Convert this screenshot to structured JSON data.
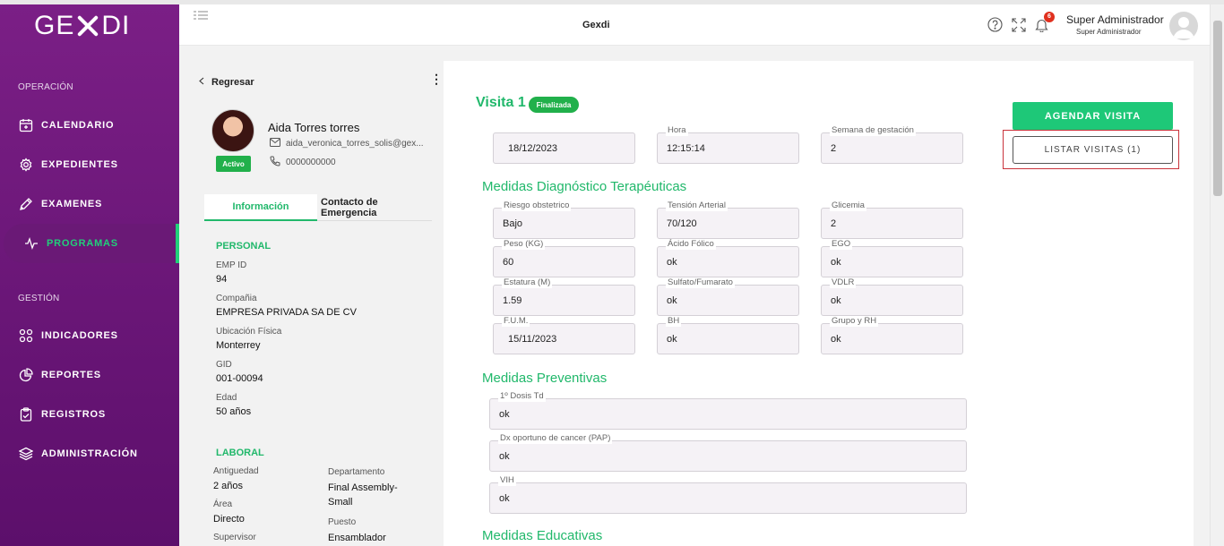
{
  "sidebar": {
    "logo_left": "GE",
    "logo_right": "DI",
    "section_operacion": "OPERACIÓN",
    "section_gestion": "GESTIÓN",
    "items": [
      {
        "label": "CALENDARIO",
        "icon": "calendar-icon"
      },
      {
        "label": "EXPEDIENTES",
        "icon": "gear-icon"
      },
      {
        "label": "EXAMENES",
        "icon": "pencil-icon"
      },
      {
        "label": "PROGRAMAS",
        "icon": "pulse-icon"
      },
      {
        "label": "INDICADORES",
        "icon": "grid-icon"
      },
      {
        "label": "REPORTES",
        "icon": "pie-chart-icon"
      },
      {
        "label": "REGISTROS",
        "icon": "clipboard-icon"
      },
      {
        "label": "ADMINISTRACIÓN",
        "icon": "layers-icon"
      }
    ],
    "active_color": "#21d07a"
  },
  "header": {
    "title": "Gexdi",
    "notification_count": "6",
    "user_name": "Super Administrador",
    "user_role": "Super Administrador"
  },
  "profile": {
    "back_label": "Regresar",
    "name": "Aida Torres torres",
    "email": "aida_veronica_torres_solis@gex...",
    "phone": "0000000000",
    "status": "Activo",
    "tabs": [
      "Información",
      "Contacto de Emergencia"
    ],
    "personal": {
      "title": "PERSONAL",
      "emp_id_label": "EMP ID",
      "emp_id": "94",
      "company_label": "Compañia",
      "company": "EMPRESA PRIVADA SA DE CV",
      "location_label": "Ubicación Física",
      "location": "Monterrey",
      "gid_label": "GID",
      "gid": "001-00094",
      "age_label": "Edad",
      "age": "50 años"
    },
    "laboral": {
      "title": "LABORAL",
      "seniority_label": "Antiguedad",
      "seniority": "2 años",
      "department_label": "Departamento",
      "department_line1": "Final Assembly-",
      "department_line2": "Small",
      "area_label": "Área",
      "area": "Directo",
      "position_label": "Puesto",
      "position": "Ensamblador",
      "supervisor_label": "Supervisor"
    }
  },
  "visit": {
    "title": "Visita 1",
    "status": "Finalizada",
    "schedule_button": "AGENDAR VISITA",
    "list_button": "LISTAR VISITAS (1)",
    "date": "18/12/2023",
    "time_label": "Hora",
    "time": "12:15:14",
    "week_label": "Semana de gestación",
    "week": "2",
    "diagnostic_title": "Medidas Diagnóstico Terapéuticas",
    "fields": {
      "riesgo_label": "Riesgo obstetrico",
      "riesgo": "Bajo",
      "tension_label": "Tensión Arterial",
      "tension": "70/120",
      "glicemia_label": "Glicemia",
      "glicemia": "2",
      "peso_label": "Peso (KG)",
      "peso": "60",
      "acido_label": "Ácido Fólico",
      "acido": "ok",
      "ego_label": "EGO",
      "ego": "ok",
      "estatura_label": "Estatura (M)",
      "estatura": "1.59",
      "sulfato_label": "Sulfato/Fumarato",
      "sulfato": "ok",
      "vdlr_label": "VDLR",
      "vdlr": "ok",
      "fum_label": "F.U.M.",
      "fum": "15/11/2023",
      "bh_label": "BH",
      "bh": "ok",
      "grupo_label": "Grupo y RH",
      "grupo": "ok"
    },
    "preventive_title": "Medidas Preventivas",
    "preventive": {
      "dosis_label": "1º Dosis Td",
      "dosis": "ok",
      "pap_label": "Dx oportuno de cancer (PAP)",
      "pap": "ok",
      "vih_label": "VIH",
      "vih": "ok"
    },
    "educational_title": "Medidas Educativas"
  }
}
